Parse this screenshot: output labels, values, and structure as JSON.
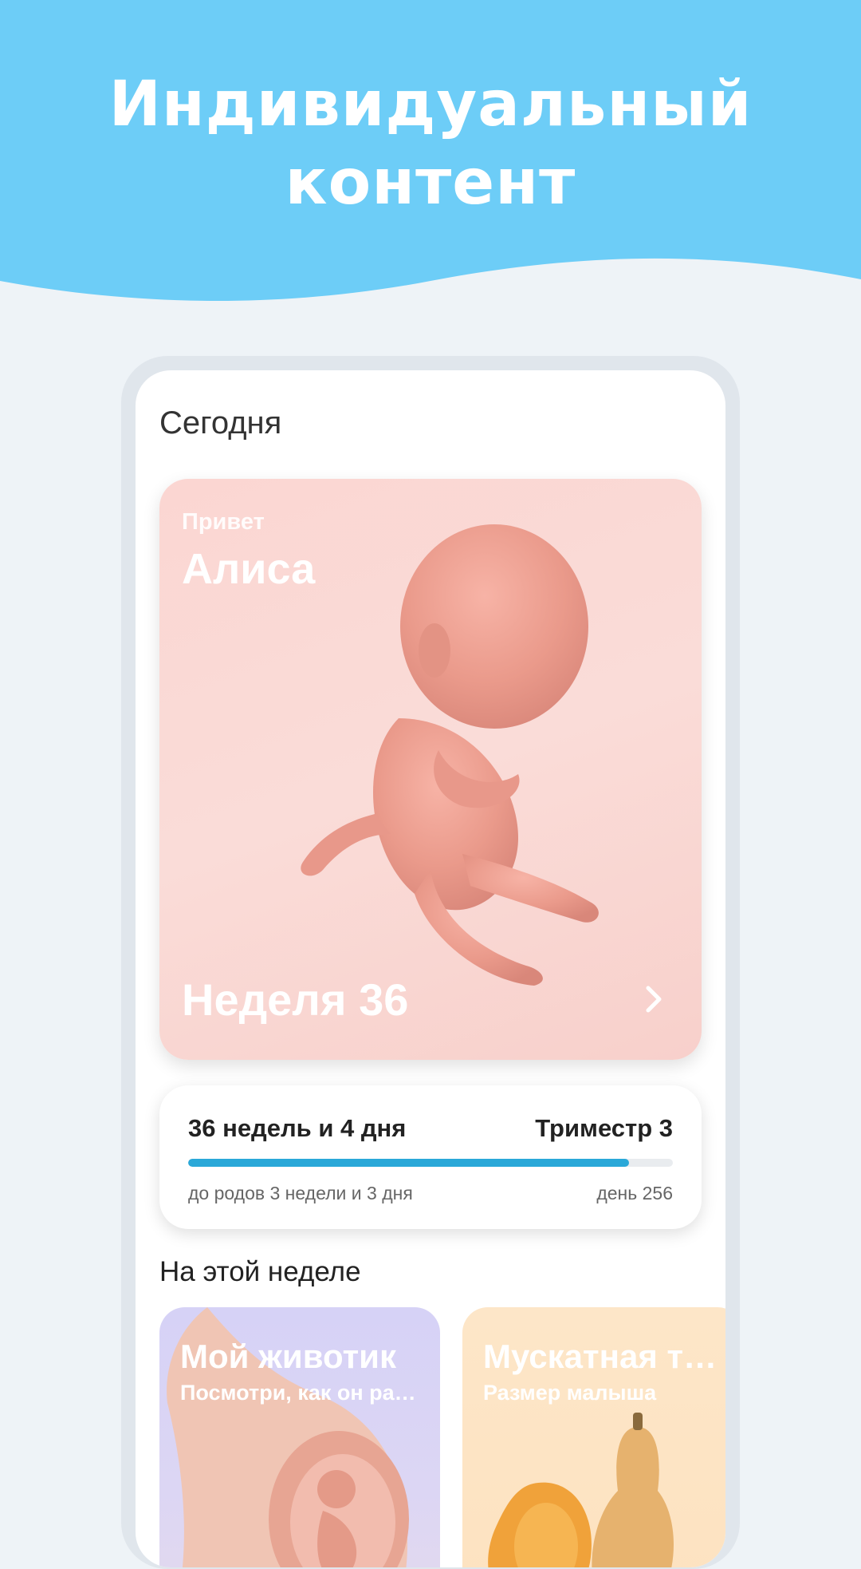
{
  "hero": {
    "title_line1": "Индивидуальный",
    "title_line2": "контент",
    "color": "#6dcdf7"
  },
  "screen": {
    "section_today": "Сегодня",
    "baby_card": {
      "greeting": "Привет",
      "name": "Алиса",
      "week": "Неделя 36",
      "background": "#fbd6d2"
    },
    "progress": {
      "elapsed": "36 недель и 4 дня",
      "trimester": "Триместр 3",
      "remaining": "до родов 3 недели и 3 дня",
      "day": "день 256",
      "fill_percent": 91,
      "bar_color": "#2aa8d8"
    },
    "this_week_heading": "На этой неделе",
    "tiles": [
      {
        "title": "Мой животик",
        "subtitle": "Посмотри, как он растёт",
        "background": "#d6d2f6"
      },
      {
        "title": "Мускатная тыква",
        "subtitle": "Размер малыша",
        "background": "#fde6c8"
      }
    ]
  }
}
